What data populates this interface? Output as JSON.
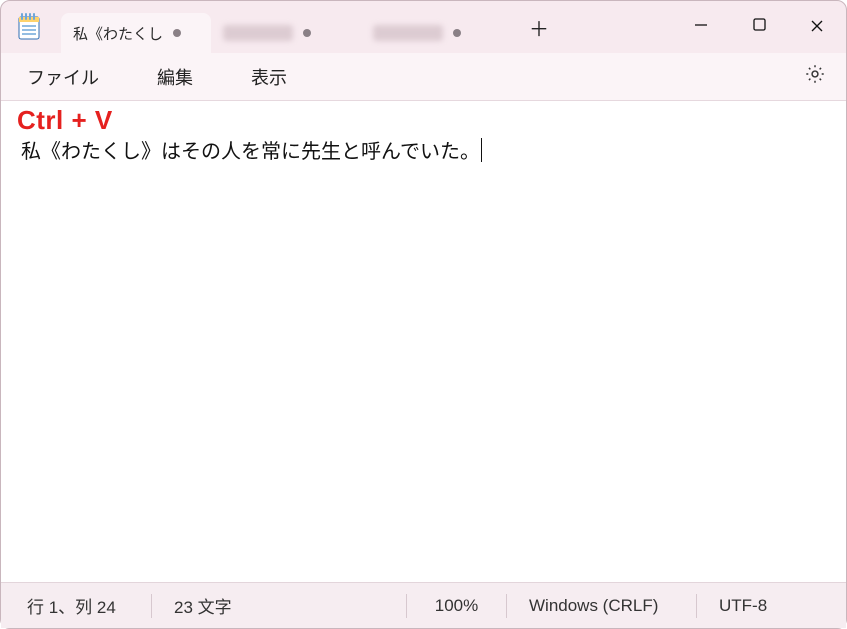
{
  "window": {
    "app_name": "Notepad"
  },
  "tabs": {
    "active": {
      "title": "私《わたくし",
      "modified": true
    },
    "inactive": [
      {
        "modified": true
      },
      {
        "modified": true
      }
    ],
    "new_tab_glyph": "＋"
  },
  "window_controls": {
    "minimize": "—",
    "maximize": "▢",
    "close": "✕"
  },
  "menubar": {
    "file": "ファイル",
    "edit": "編集",
    "view": "表示"
  },
  "overlay": {
    "shortcut_hint": "Ctrl + V"
  },
  "editor": {
    "content": "私《わたくし》はその人を常に先生と呼んでいた。"
  },
  "statusbar": {
    "position": "行 1、列 24",
    "chars": "23 文字",
    "zoom": "100%",
    "line_ending": "Windows (CRLF)",
    "encoding": "UTF-8"
  }
}
